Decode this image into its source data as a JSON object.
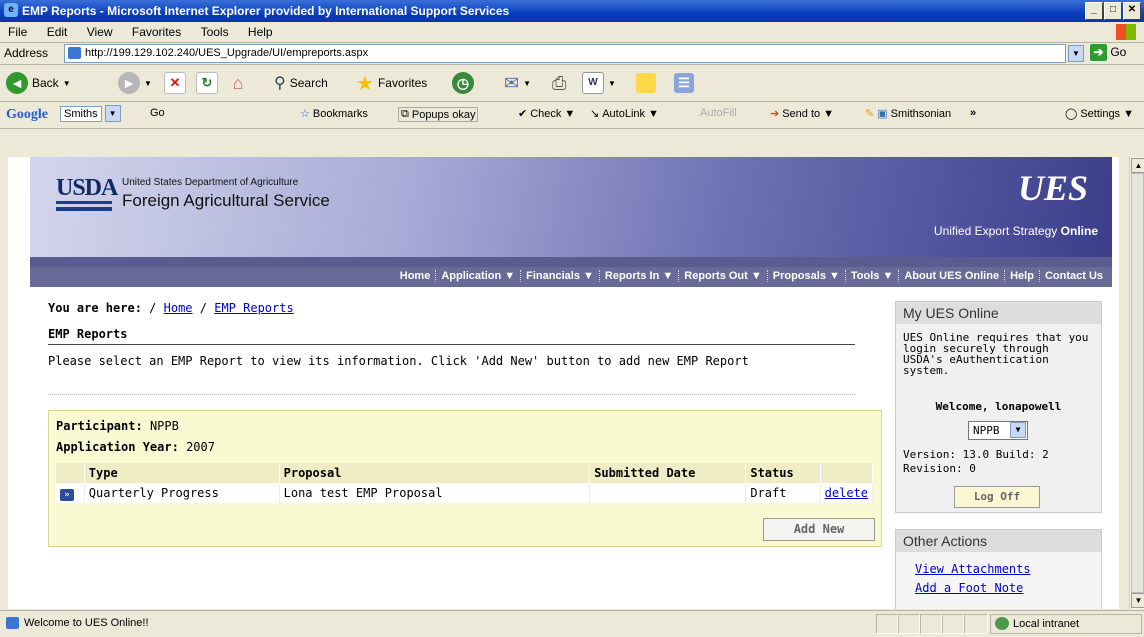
{
  "window": {
    "title": "EMP Reports - Microsoft Internet Explorer provided by International Support Services"
  },
  "menu": [
    "File",
    "Edit",
    "View",
    "Favorites",
    "Tools",
    "Help"
  ],
  "address": {
    "label": "Address",
    "url": "http://199.129.102.240/UES_Upgrade/UI/empreports.aspx",
    "go": "Go"
  },
  "toolbar": {
    "back": "Back",
    "search": "Search",
    "favorites": "Favorites"
  },
  "google_toolbar": {
    "logo": "Google",
    "search_box": "Smiths",
    "go": "Go",
    "bookmarks": "Bookmarks",
    "popups": "Popups okay",
    "check": "Check",
    "autolink": "AutoLink",
    "autofill": "AutoFill",
    "sendto": "Send to",
    "smithsonian": "Smithsonian",
    "more": "»",
    "settings": "Settings"
  },
  "banner": {
    "usda": "USDA",
    "department": "United States Department of Agriculture",
    "agency": "Foreign Agricultural Service",
    "ues_mark": "UES",
    "tagline_prefix": "Unified Export Strategy",
    "tagline_suffix": "Online"
  },
  "nav": [
    "Home",
    "Application ▼",
    "Financials ▼",
    "Reports In ▼",
    "Reports Out ▼",
    "Proposals ▼",
    "Tools ▼",
    "About UES Online",
    "Help",
    "Contact Us"
  ],
  "breadcrumb": {
    "label": "You are here:",
    "home": "Home",
    "current": "EMP Reports",
    "sep": "/"
  },
  "page": {
    "title": "EMP Reports",
    "instructions": "Please select an EMP Report to view its information. Click 'Add New' button to add new EMP Report"
  },
  "panel": {
    "participant_label": "Participant:",
    "participant": "NPPB",
    "year_label": "Application Year:",
    "year": "2007",
    "columns": [
      "Type",
      "Proposal",
      "Submitted Date",
      "Status",
      ""
    ],
    "rows": [
      {
        "type": "Quarterly Progress",
        "proposal": "Lona test EMP Proposal",
        "submitted": "",
        "status": "Draft",
        "action": "delete"
      }
    ],
    "add_new": "Add New"
  },
  "sidebar": {
    "my_title": "My UES Online",
    "login_msg": "UES Online requires that you login securely through USDA's eAuthentication system.",
    "welcome": "Welcome, lonapowell",
    "participant_select": "NPPB",
    "version": "Version: 13.0 Build: 2 Revision: 0",
    "logoff": "Log Off",
    "other_title": "Other Actions",
    "other_links": [
      "View Attachments",
      "Add a Foot Note"
    ]
  },
  "status": {
    "message": "Welcome to UES Online!!",
    "zone": "Local intranet"
  }
}
